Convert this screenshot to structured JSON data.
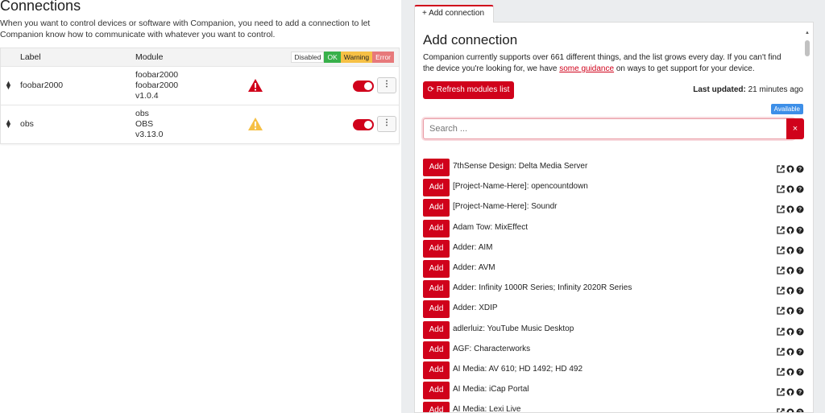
{
  "page": {
    "title": "Connections",
    "intro": "When you want to control devices or software with Companion, you need to add a connection to let Companion know how to communicate with whatever you want to control."
  },
  "table": {
    "headers": {
      "label": "Label",
      "module": "Module"
    },
    "legend": {
      "disabled": "Disabled",
      "ok": "OK",
      "warning": "Warning",
      "error": "Error"
    },
    "rows": [
      {
        "label": "foobar2000",
        "module_id": "foobar2000",
        "module_name": "foobar2000",
        "version": "v1.0.4",
        "status": "error",
        "enabled": true
      },
      {
        "label": "obs",
        "module_id": "obs",
        "module_name": "OBS",
        "version": "v3.13.0",
        "status": "warning",
        "enabled": true
      }
    ]
  },
  "add_panel": {
    "tab_label": "+ Add connection",
    "title": "Add connection",
    "desc_before": "Companion currently supports over 661 different things, and the list grows every day. If you can't find the device you're looking for, we have ",
    "desc_link": "some guidance",
    "desc_after": " on ways to get support for your device.",
    "refresh_label": "Refresh modules list",
    "last_updated_label": "Last updated:",
    "last_updated_value": "21 minutes ago",
    "available_badge": "Available",
    "search_placeholder": "Search ...",
    "clear_label": "×",
    "add_label": "Add",
    "modules": [
      "7thSense Design: Delta Media Server",
      "[Project-Name-Here]: opencountdown",
      "[Project-Name-Here]: Soundr",
      "Adam Tow: MixEffect",
      "Adder: AIM",
      "Adder: AVM",
      "Adder: Infinity 1000R Series; Infinity 2020R Series",
      "Adder: XDIP",
      "adlerluiz: YouTube Music Desktop",
      "AGF: Characterworks",
      "AI Media: AV 610; HD 1492; HD 492",
      "AI Media: iCap Portal",
      "AI Media: Lexi Live"
    ]
  },
  "colors": {
    "accent": "#d0021b",
    "ok": "#38b04a",
    "warning": "#f6c045",
    "error": "#e7797b",
    "info": "#3d8fe8"
  }
}
